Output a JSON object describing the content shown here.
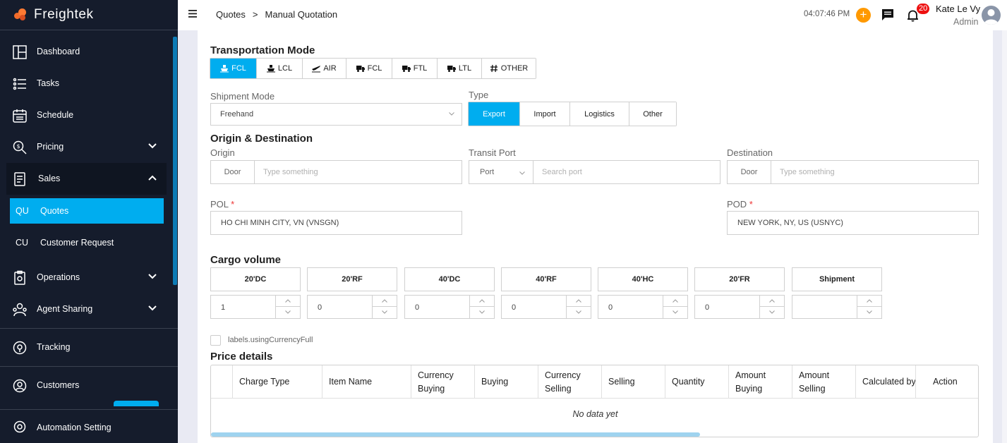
{
  "app": {
    "name": "Freightek"
  },
  "sidebar": {
    "items": [
      {
        "label": "Dashboard"
      },
      {
        "label": "Tasks"
      },
      {
        "label": "Schedule"
      },
      {
        "label": "Pricing"
      },
      {
        "label": "Sales"
      },
      {
        "label": "Operations"
      },
      {
        "label": "Agent Sharing"
      },
      {
        "label": "Tracking"
      },
      {
        "label": "Customers"
      },
      {
        "label": "Automation Setting"
      }
    ],
    "sub_items": [
      {
        "code": "QU",
        "label": "Quotes",
        "active": true
      },
      {
        "code": "CU",
        "label": "Customer Request",
        "active": false
      }
    ]
  },
  "header": {
    "breadcrumb": [
      "Quotes",
      ">",
      "Manual Quotation"
    ],
    "time": "04:07:46 PM",
    "add_label": "+",
    "notifications": "20",
    "user_name": "Kate Le Vy",
    "user_role": "Admin"
  },
  "form": {
    "transport_title": "Transportation Mode",
    "transport_modes": [
      {
        "label": "FCL",
        "icon": "ship-icon",
        "selected": true
      },
      {
        "label": "LCL",
        "icon": "ship-icon",
        "selected": false
      },
      {
        "label": "AIR",
        "icon": "plane-icon",
        "selected": false
      },
      {
        "label": "FCL",
        "icon": "truck-icon",
        "selected": false
      },
      {
        "label": "FTL",
        "icon": "truck-icon",
        "selected": false
      },
      {
        "label": "LTL",
        "icon": "truck-icon",
        "selected": false
      },
      {
        "label": "OTHER",
        "icon": "hash-icon",
        "selected": false
      }
    ],
    "shipment_mode_label": "Shipment Mode",
    "shipment_mode_value": "Freehand",
    "type_label": "Type",
    "types": [
      {
        "label": "Export",
        "selected": true
      },
      {
        "label": "Import",
        "selected": false
      },
      {
        "label": "Logistics",
        "selected": false
      },
      {
        "label": "Other",
        "selected": false
      }
    ],
    "od_title": "Origin & Destination",
    "origin_label": "Origin",
    "origin_prefix": "Door",
    "origin_placeholder": "Type something",
    "transit_label": "Transit Port",
    "transit_prefix": "Port",
    "transit_placeholder": "Search port",
    "destination_label": "Destination",
    "destination_prefix": "Door",
    "destination_placeholder": "Type something",
    "pol_label": "POL",
    "pol_value": "HO CHI MINH CITY, VN (VNSGN)",
    "pod_label": "POD",
    "pod_value": "NEW YORK, NY, US (USNYC)",
    "required_mark": "*",
    "cargo_title": "Cargo volume",
    "containers": [
      {
        "label": "20'DC",
        "value": "1"
      },
      {
        "label": "20'RF",
        "value": "0"
      },
      {
        "label": "40'DC",
        "value": "0"
      },
      {
        "label": "40'RF",
        "value": "0"
      },
      {
        "label": "40'HC",
        "value": "0"
      },
      {
        "label": "20'FR",
        "value": "0"
      },
      {
        "label": "Shipment",
        "value": ""
      }
    ],
    "currency_checkbox_label": "labels.usingCurrencyFull"
  },
  "price_table": {
    "title": "Price details",
    "columns": [
      "Charge Type",
      "Item Name",
      "Currency Buying",
      "Buying",
      "Currency Selling",
      "Selling",
      "Quantity",
      "Amount Buying",
      "Amount Selling",
      "Calculated by",
      "Action"
    ],
    "empty_text": "No data yet"
  }
}
